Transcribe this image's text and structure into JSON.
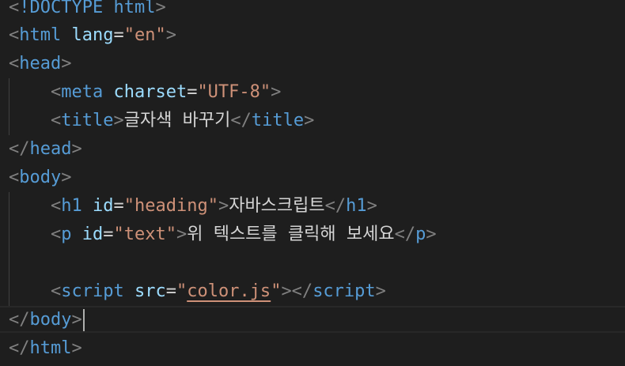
{
  "code": {
    "doctype": "!DOCTYPE html",
    "html_tag": "html",
    "lang_attr": "lang",
    "lang_val": "\"en\"",
    "head_tag": "head",
    "meta_tag": "meta",
    "charset_attr": "charset",
    "charset_val": "\"UTF-8\"",
    "title_tag": "title",
    "title_text": "글자색 바꾸기",
    "body_tag": "body",
    "h1_tag": "h1",
    "id_attr": "id",
    "h1_id": "\"heading\"",
    "h1_text": "자바스크립트",
    "p_tag": "p",
    "p_id": "\"text\"",
    "p_text": "위 텍스트를 클릭해 보세요",
    "script_tag": "script",
    "src_attr": "src",
    "src_val_open": "\"",
    "src_val_link": "color.js",
    "src_val_close": "\""
  },
  "colors": {
    "background": "#1e1e1e",
    "tag": "#569cd6",
    "attribute": "#9cdcfe",
    "string": "#ce9178",
    "bracket": "#808080",
    "text": "#d4d4d4"
  }
}
